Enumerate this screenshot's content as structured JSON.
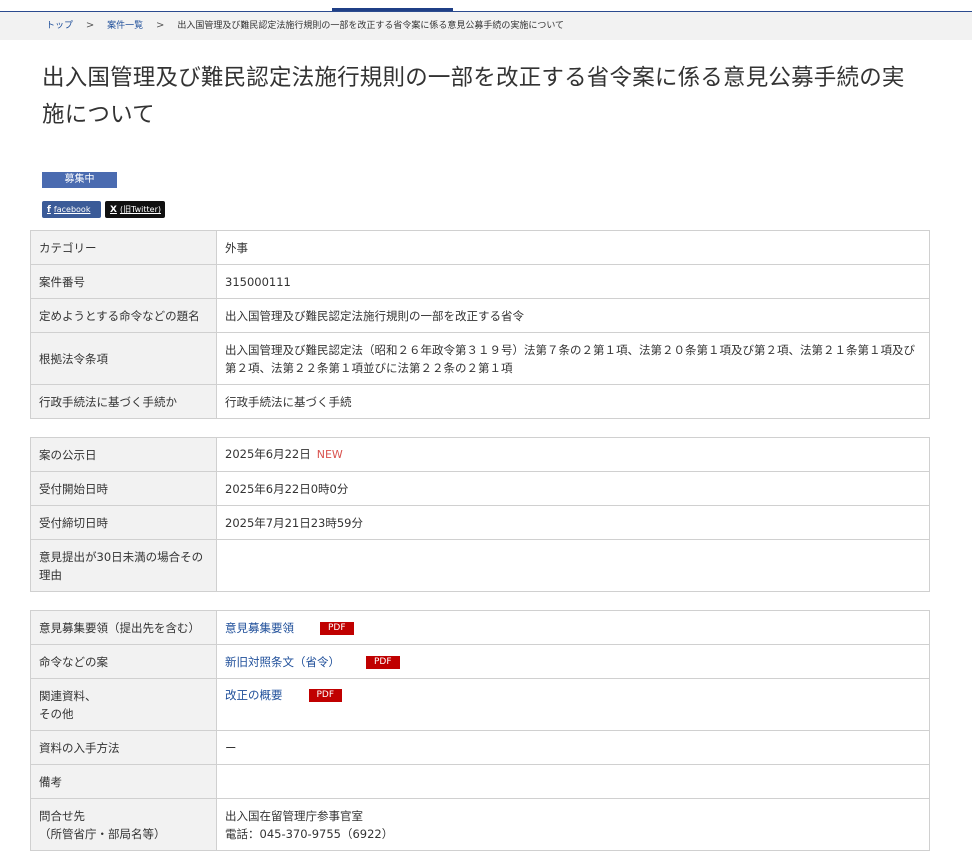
{
  "breadcrumb": {
    "home": "トップ",
    "list": "案件一覧",
    "current": "出入国管理及び難民認定法施行規則の一部を改正する省令案に係る意見公募手続の実施について",
    "separator": ">"
  },
  "title": "出入国管理及び難民認定法施行規則の一部を改正する省令案に係る意見公募手続の実施について",
  "status": "募集中",
  "share": {
    "facebook_icon": "f",
    "facebook_label": "facebook",
    "x_icon": "X",
    "x_label": "(旧Twitter)"
  },
  "table1": {
    "rows": [
      {
        "label": "カテゴリー",
        "value": "外事"
      },
      {
        "label": "案件番号",
        "value": "315000111"
      },
      {
        "label": "定めようとする命令などの題名",
        "value": "出入国管理及び難民認定法施行規則の一部を改正する省令"
      },
      {
        "label": "根拠法令条項",
        "value": "出入国管理及び難民認定法（昭和２６年政令第３１９号）法第７条の２第１項、法第２０条第１項及び第２項、法第２１条第１項及び第２項、法第２２条第１項並びに法第２２条の２第１項"
      },
      {
        "label": "行政手続法に基づく手続か",
        "value": "行政手続法に基づく手続"
      }
    ]
  },
  "table2": {
    "rows": [
      {
        "label": "案の公示日",
        "value": "2025年6月22日",
        "tag": "NEW"
      },
      {
        "label": "受付開始日時",
        "value": "2025年6月22日0時0分"
      },
      {
        "label": "受付締切日時",
        "value": "2025年7月21日23時59分"
      },
      {
        "label": "意見提出が30日未満の場合その理由",
        "value": ""
      }
    ]
  },
  "table3": {
    "rows": [
      {
        "label": "意見募集要領（提出先を含む）",
        "link": "意見募集要領",
        "pdf": "PDF"
      },
      {
        "label": "命令などの案",
        "link": "新旧対照条文（省令）",
        "pdf": "PDF"
      },
      {
        "label": "関連資料、\nその他",
        "link": "改正の概要",
        "pdf": "PDF"
      },
      {
        "label": "資料の入手方法",
        "value": "ー"
      },
      {
        "label": "備考",
        "value": ""
      },
      {
        "label": "問合せ先\n（所管省庁・部局名等）",
        "value": "出入国在留管理庁参事官室\n電話：045-370-9755（6922）"
      }
    ]
  },
  "colors": {
    "accent": "#1f3f86",
    "badge": "#4a6bb0",
    "link": "#1f4f9a",
    "pdf": "#c00000",
    "new": "#d9534f"
  }
}
